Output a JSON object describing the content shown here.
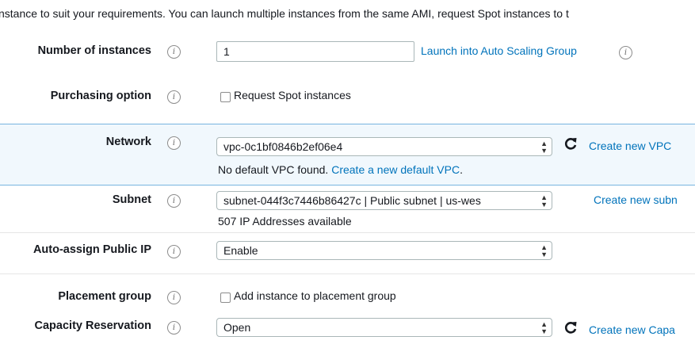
{
  "intro_text": "nstance to suit your requirements. You can launch multiple instances from the same AMI, request Spot instances to t",
  "info_glyph": "i",
  "rows": {
    "instances": {
      "label": "Number of instances",
      "value": "1",
      "link": "Launch into Auto Scaling Group"
    },
    "purchasing": {
      "label": "Purchasing option",
      "checkbox_label": "Request Spot instances"
    },
    "network": {
      "label": "Network",
      "value": "vpc-0c1bf0846b2ef06e4",
      "link": "Create new VPC",
      "note_text": "No default VPC found.",
      "note_link": "Create a new default VPC",
      "note_period": "."
    },
    "subnet": {
      "label": "Subnet",
      "value": "subnet-044f3c7446b86427c | Public subnet | us-wes",
      "link": "Create new subn",
      "note_text": "507 IP Addresses available"
    },
    "public_ip": {
      "label": "Auto-assign Public IP",
      "value": "Enable"
    },
    "placement": {
      "label": "Placement group",
      "checkbox_label": "Add instance to placement group"
    },
    "capacity": {
      "label": "Capacity Reservation",
      "value": "Open",
      "link": "Create new Capa"
    }
  },
  "icons": {
    "info": "info-icon",
    "refresh": "refresh-icon",
    "select_arrows": "select-arrows-icon"
  },
  "colors": {
    "link": "#0073bb",
    "band_background": "#f1f8fd",
    "band_border": "#78b4e0"
  }
}
